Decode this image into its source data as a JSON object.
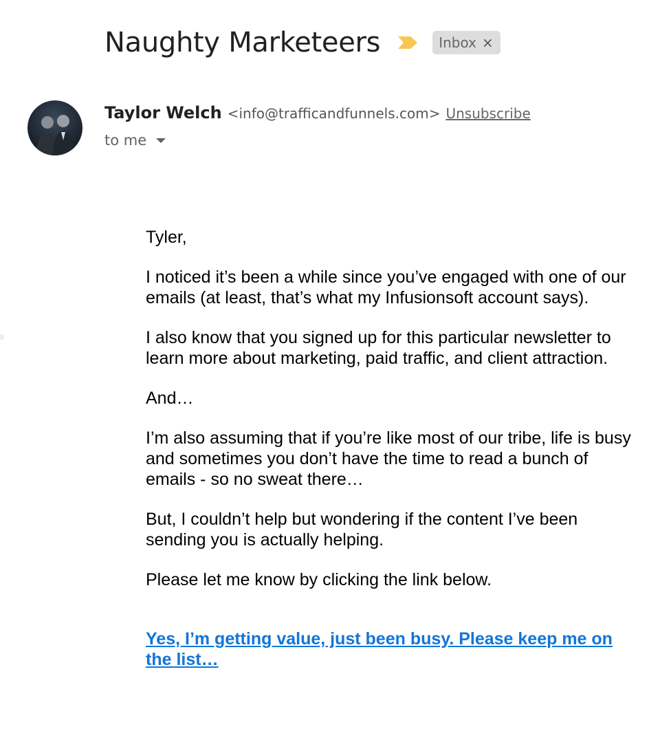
{
  "header": {
    "subject": "Naughty Marketeers",
    "importance_icon": "importance-marker-icon",
    "label": "Inbox",
    "label_remove": "×",
    "colors": {
      "importance": "#f7c653",
      "chip_bg": "#dddddd"
    }
  },
  "sender": {
    "name": "Taylor Welch",
    "email": "<info@trafficandfunnels.com>",
    "unsubscribe": "Unsubscribe",
    "recipient": "to me",
    "avatar": "avatar-photo"
  },
  "message": {
    "greeting": "Tyler,",
    "paragraphs": [
      "I noticed it’s been a while since you’ve engaged with one of our emails (at least, that’s what my Infusionsoft account says).",
      "I also know that you signed up for this particular newsletter to learn more about marketing, paid traffic, and client attraction.",
      "And…",
      "I’m also assuming that if you’re like most of our tribe, life is busy and sometimes you don’t have the time to read a bunch of emails - so no sweat there…",
      "But, I couldn’t help but wondering if the content I’ve been sending you is actually helping.",
      "Please let me know by clicking the link below."
    ],
    "cta_link": "Yes, I’m getting value, just been busy. Please keep me on the list…",
    "colors": {
      "link": "#1275d8"
    }
  }
}
